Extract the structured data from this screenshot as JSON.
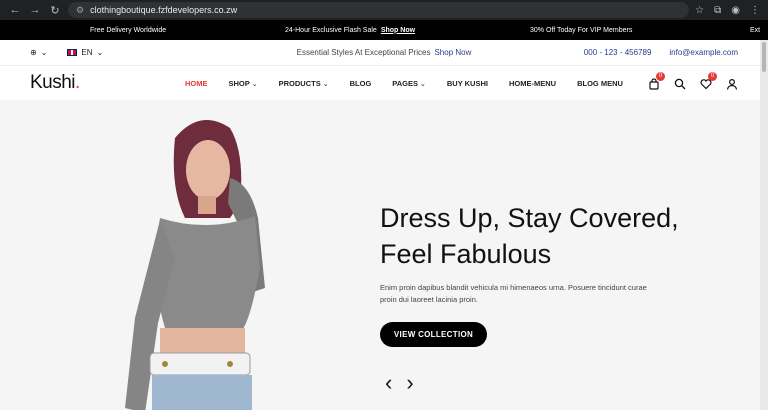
{
  "browser": {
    "url": "clothingboutique.fzfdevelopers.co.zw"
  },
  "marquee": {
    "items": [
      "Free Delivery Worldwide",
      "24-Hour Exclusive Flash Sale",
      "30% Off Today For VIP Members",
      "Ext"
    ],
    "shop_now": "Shop Now"
  },
  "utility": {
    "language": "EN",
    "tagline": "Essential Styles At Exceptional Prices",
    "tagline_link": "Shop Now",
    "phone": "000 - 123 - 456789",
    "email": "info@example.com"
  },
  "header": {
    "logo": "Kushi",
    "logo_dot": ".",
    "menu": [
      {
        "label": "HOME"
      },
      {
        "label": "SHOP"
      },
      {
        "label": "PRODUCTS"
      },
      {
        "label": "BLOG"
      },
      {
        "label": "PAGES"
      },
      {
        "label": "BUY KUSHI"
      },
      {
        "label": "HOME-MENU"
      },
      {
        "label": "BLOG MENU"
      }
    ],
    "cart_count": "0",
    "wishlist_count": "0"
  },
  "hero": {
    "headline_line1": "Dress Up, Stay Covered,",
    "headline_line2": "Feel Fabulous",
    "subtext": "Enim proin dapibus blandit vehicula mi himenaeos urna. Posuere tincidunt curae proin dui laoreet lacinia proin.",
    "cta": "VIEW COLLECTION"
  },
  "colors": {
    "accent": "#e53935",
    "link": "#2c3a8c",
    "button": "#000000"
  }
}
